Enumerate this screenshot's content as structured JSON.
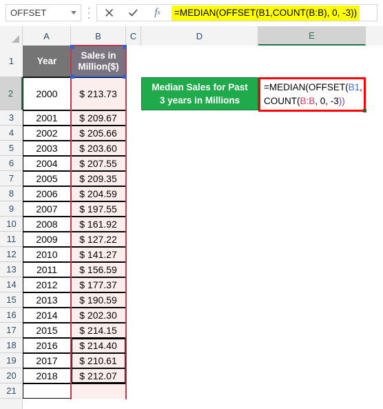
{
  "formula_bar": {
    "name_box_value": "OFFSET",
    "cancel_icon": "close-icon",
    "confirm_icon": "check-icon",
    "function_icon": "fx-icon",
    "formula_text": "=MEDIAN(OFFSET(B1,COUNT(B:B), 0, -3))"
  },
  "grid": {
    "column_headers": [
      "A",
      "B",
      "C",
      "D",
      "E"
    ],
    "active_column": "E",
    "active_row": "2",
    "row_numbers": [
      "1",
      "2",
      "3",
      "4",
      "5",
      "6",
      "7",
      "8",
      "9",
      "10",
      "11",
      "12",
      "13",
      "14",
      "15",
      "16",
      "17",
      "18",
      "19",
      "20",
      "21"
    ],
    "header_row": {
      "a": "Year",
      "b_line1": "Sales in",
      "b_line2": "Million($)"
    },
    "rows": [
      {
        "row": "2",
        "year": "2000",
        "sales": "$ 213.73"
      },
      {
        "row": "3",
        "year": "2001",
        "sales": "$ 209.67"
      },
      {
        "row": "4",
        "year": "2002",
        "sales": "$ 205.66"
      },
      {
        "row": "5",
        "year": "2003",
        "sales": "$ 203.60"
      },
      {
        "row": "6",
        "year": "2004",
        "sales": "$ 207.55"
      },
      {
        "row": "7",
        "year": "2005",
        "sales": "$ 209.35"
      },
      {
        "row": "8",
        "year": "2006",
        "sales": "$ 204.59"
      },
      {
        "row": "9",
        "year": "2007",
        "sales": "$ 197.55"
      },
      {
        "row": "10",
        "year": "2008",
        "sales": "$ 161.92"
      },
      {
        "row": "11",
        "year": "2009",
        "sales": "$ 127.22"
      },
      {
        "row": "12",
        "year": "2010",
        "sales": "$ 141.27"
      },
      {
        "row": "13",
        "year": "2011",
        "sales": "$ 156.59"
      },
      {
        "row": "14",
        "year": "2012",
        "sales": "$ 177.37"
      },
      {
        "row": "15",
        "year": "2013",
        "sales": "$ 190.59"
      },
      {
        "row": "16",
        "year": "2014",
        "sales": "$ 202.30"
      },
      {
        "row": "17",
        "year": "2015",
        "sales": "$ 214.15"
      },
      {
        "row": "18",
        "year": "2016",
        "sales": "$ 214.40"
      },
      {
        "row": "19",
        "year": "2017",
        "sales": "$ 210.61"
      },
      {
        "row": "20",
        "year": "2018",
        "sales": "$ 212.07"
      }
    ],
    "label_cell": {
      "line1": "Median Sales for Past",
      "line2": "3 years in Millions"
    },
    "formula_cell": {
      "seg1": "=MEDIAN(OFFSET(",
      "ref1": "B1",
      "seg2": ", COUNT(",
      "ref2": "B:B",
      "seg3": ", 0, -3",
      "seg4": "))"
    }
  },
  "colors": {
    "highlight_yellow": "#ffff00",
    "label_green": "#1faa4b",
    "formula_border_red": "#ff0000",
    "range_red": "#c0394b",
    "ref_blue": "#4169d8",
    "excel_green": "#217346",
    "pink_fill": "#fdeeee",
    "header_gray": "#757575"
  }
}
